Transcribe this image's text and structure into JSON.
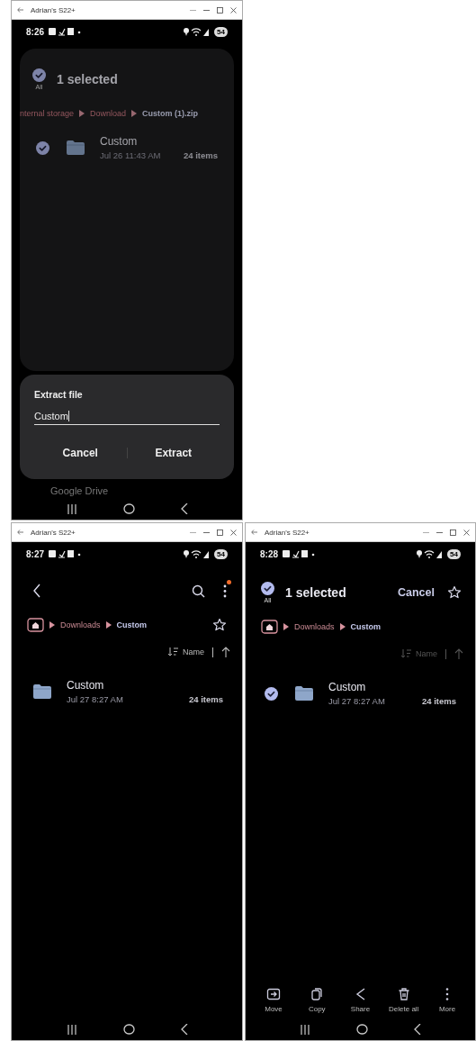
{
  "windows": [
    {
      "kind": "extract",
      "title": "Adrian's S22+",
      "time": "8:26",
      "battery": "54",
      "dimmed": true,
      "selection_header": {
        "all_label": "All",
        "all_checked": true,
        "title": "1 selected"
      },
      "breadcrumb": [
        {
          "label": "nternal storage",
          "current": false
        },
        {
          "label": "Download",
          "current": false
        },
        {
          "label": "Custom (1).zip",
          "current": true
        }
      ],
      "items": [
        {
          "name": "Custom",
          "date": "Jul 26 11:43 AM",
          "count": "24 items",
          "checked": true
        }
      ],
      "dialog": {
        "title": "Extract file",
        "value": "Custom",
        "buttons": [
          "Cancel",
          "Extract"
        ]
      },
      "behind_text": "Google Drive"
    },
    {
      "kind": "browse",
      "title": "Adrian's S22+",
      "time": "8:27",
      "battery": "54",
      "dimmed": false,
      "app_bar": {
        "notification": true
      },
      "breadcrumb": [
        {
          "label": "Downloads",
          "current": false
        },
        {
          "label": "Custom",
          "current": true
        }
      ],
      "sort": {
        "label": "Name",
        "disabled": false
      },
      "items": [
        {
          "name": "Custom",
          "date": "Jul 27 8:27 AM",
          "count": "24 items"
        }
      ]
    },
    {
      "kind": "select",
      "title": "Adrian's S22+",
      "time": "8:28",
      "battery": "54",
      "dimmed": false,
      "selection_header": {
        "all_label": "All",
        "all_checked": true,
        "title": "1 selected",
        "cancel": "Cancel"
      },
      "breadcrumb": [
        {
          "label": "Downloads",
          "current": false
        },
        {
          "label": "Custom",
          "current": true
        }
      ],
      "sort": {
        "label": "Name",
        "disabled": true
      },
      "items": [
        {
          "name": "Custom",
          "date": "Jul 27 8:27 AM",
          "count": "24 items",
          "checked": true
        }
      ],
      "actions": [
        {
          "kind": "move",
          "label": "Move"
        },
        {
          "kind": "copy",
          "label": "Copy"
        },
        {
          "kind": "share",
          "label": "Share"
        },
        {
          "kind": "delete",
          "label": "Delete all"
        },
        {
          "kind": "more",
          "label": "More"
        }
      ]
    }
  ]
}
